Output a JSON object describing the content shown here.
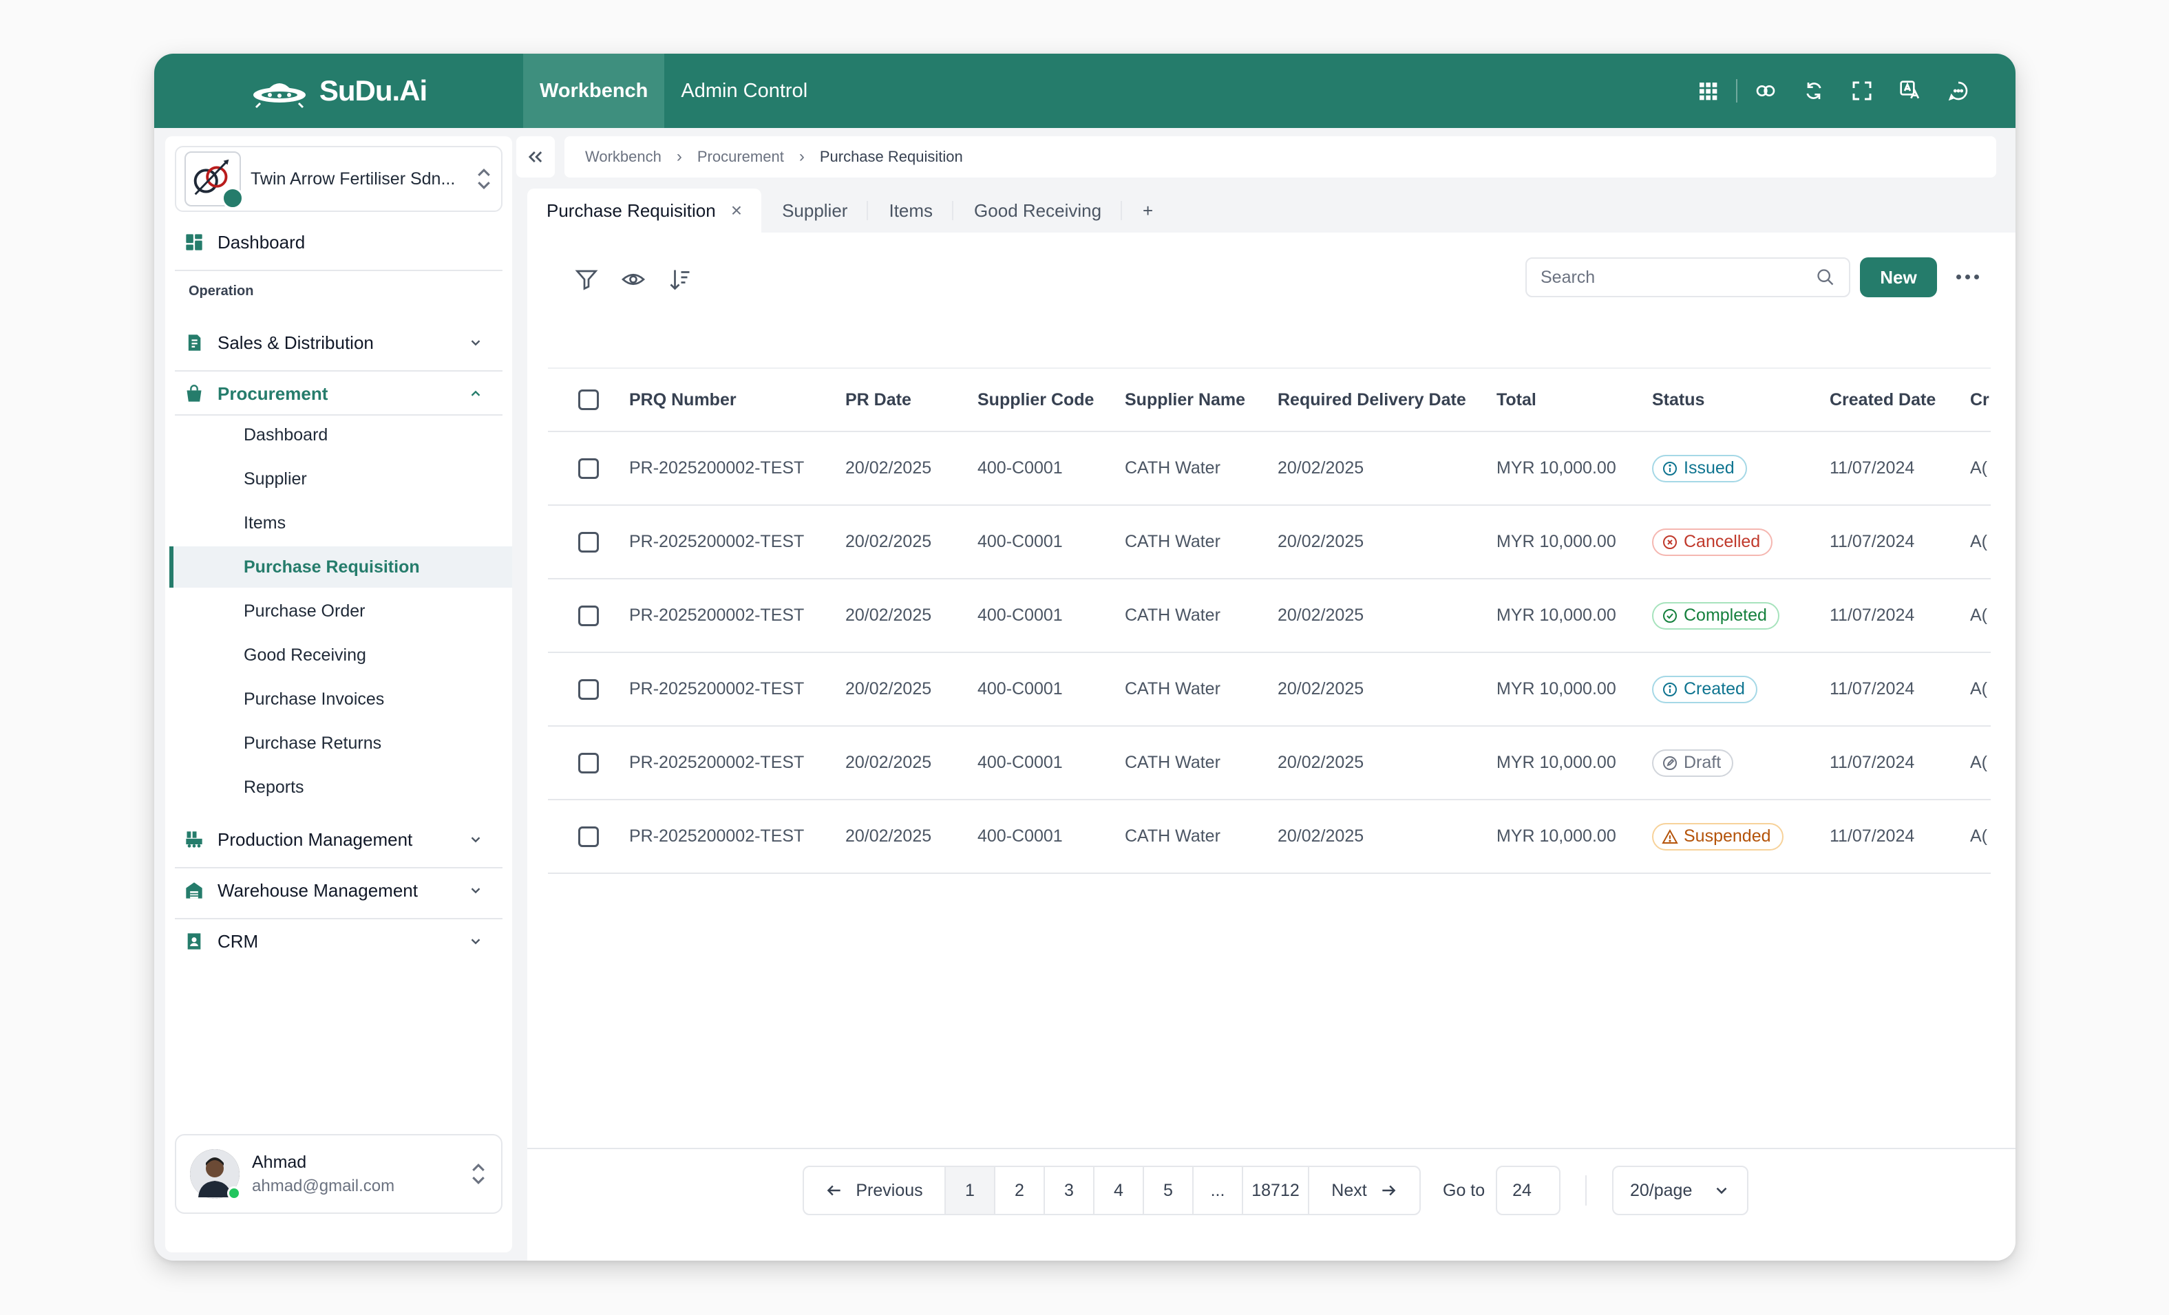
{
  "brand": {
    "name": "SuDu.Ai"
  },
  "topnav": [
    {
      "label": "Workbench",
      "active": true
    },
    {
      "label": "Admin Control",
      "active": false
    }
  ],
  "top_actions": [
    "apps-grid-icon",
    "link-icon",
    "refresh-icon",
    "fullscreen-icon",
    "translate-icon",
    "chat-icon"
  ],
  "sidebar": {
    "company": "Twin Arrow Fertiliser Sdn...",
    "dashboard": "Dashboard",
    "section": "Operation",
    "groups": {
      "sales": "Sales & Distribution",
      "procurement": "Procurement",
      "production": "Production Management",
      "warehouse": "Warehouse Management",
      "crm": "CRM"
    },
    "procurement_items": [
      "Dashboard",
      "Supplier",
      "Items",
      "Purchase Requisition",
      "Purchase Order",
      "Good Receiving",
      "Purchase Invoices",
      "Purchase Returns",
      "Reports"
    ],
    "active_item": "Purchase Requisition",
    "user": {
      "name": "Ahmad",
      "email": "ahmad@gmail.com"
    }
  },
  "breadcrumb": [
    "Workbench",
    "Procurement",
    "Purchase Requisition"
  ],
  "tabs": [
    "Purchase Requisition",
    "Supplier",
    "Items",
    "Good Receiving"
  ],
  "tab_add": "+",
  "tab_close": "×",
  "toolbar": {
    "search_placeholder": "Search",
    "new_label": "New"
  },
  "table": {
    "columns": [
      "PRQ Number",
      "PR Date",
      "Supplier Code",
      "Supplier Name",
      "Required Delivery Date",
      "Total",
      "Status",
      "Created Date",
      "Cr"
    ],
    "rows": [
      [
        "PR-2025200002-TEST",
        "20/02/2025",
        "400-C0001",
        "CATH Water",
        "20/02/2025",
        "MYR 10,000.00",
        "Issued",
        "11/07/2024",
        "A("
      ],
      [
        "PR-2025200002-TEST",
        "20/02/2025",
        "400-C0001",
        "CATH Water",
        "20/02/2025",
        "MYR 10,000.00",
        "Cancelled",
        "11/07/2024",
        "A("
      ],
      [
        "PR-2025200002-TEST",
        "20/02/2025",
        "400-C0001",
        "CATH Water",
        "20/02/2025",
        "MYR 10,000.00",
        "Completed",
        "11/07/2024",
        "A("
      ],
      [
        "PR-2025200002-TEST",
        "20/02/2025",
        "400-C0001",
        "CATH Water",
        "20/02/2025",
        "MYR 10,000.00",
        "Created",
        "11/07/2024",
        "A("
      ],
      [
        "PR-2025200002-TEST",
        "20/02/2025",
        "400-C0001",
        "CATH Water",
        "20/02/2025",
        "MYR 10,000.00",
        "Draft",
        "11/07/2024",
        "A("
      ],
      [
        "PR-2025200002-TEST",
        "20/02/2025",
        "400-C0001",
        "CATH Water",
        "20/02/2025",
        "MYR 10,000.00",
        "Suspended",
        "11/07/2024",
        "A("
      ]
    ]
  },
  "status_styles": {
    "Issued": {
      "color": "#0e7490",
      "border": "#a5d8e6",
      "icon": "info-icon"
    },
    "Cancelled": {
      "color": "#c0392b",
      "border": "#f5b7b1",
      "icon": "x-circle-icon"
    },
    "Completed": {
      "color": "#15803d",
      "border": "#a7e3bd",
      "icon": "check-circle-icon"
    },
    "Created": {
      "color": "#0e7490",
      "border": "#a5d8e6",
      "icon": "info-icon"
    },
    "Draft": {
      "color": "#6b7280",
      "border": "#d1d5db",
      "icon": "edit-circle-icon"
    },
    "Suspended": {
      "color": "#b45309",
      "border": "#f7d29a",
      "icon": "warning-icon"
    }
  },
  "pagination": {
    "prev": "Previous",
    "pages": [
      "1",
      "2",
      "3",
      "4",
      "5",
      "...",
      "18712"
    ],
    "current": "1",
    "next": "Next",
    "goto_label": "Go to",
    "goto_value": "24",
    "per_page": "20/page"
  },
  "colors": {
    "brand": "#257c6b",
    "brand_light": "#3e8f7e"
  }
}
